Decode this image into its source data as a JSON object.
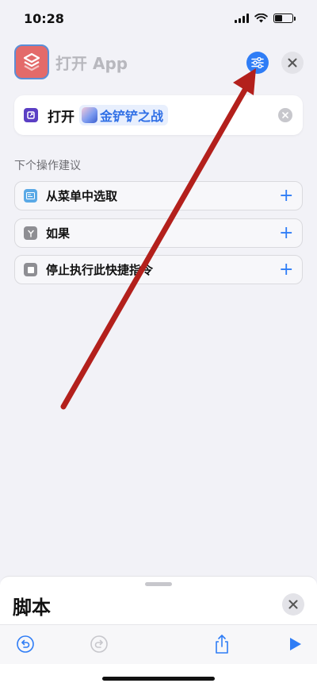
{
  "status_bar": {
    "time": "10:28",
    "battery_level": 0.45
  },
  "header": {
    "title": "打开 App",
    "app_icon": "shortcuts-icon",
    "settings_icon": "sliders-icon",
    "close_icon": "close-icon"
  },
  "action": {
    "verb": "打开",
    "app_name": "金铲铲之战",
    "icon": "open-app-icon",
    "clear_icon": "clear-icon"
  },
  "suggestions": {
    "title": "下个操作建议",
    "items": [
      {
        "label": "从菜单中选取",
        "icon": "menu-icon",
        "color": "#5aa9e6"
      },
      {
        "label": "如果",
        "icon": "branch-icon",
        "color": "#8e8e93"
      },
      {
        "label": "停止执行此快捷指令",
        "icon": "stop-icon",
        "color": "#8e8e93"
      }
    ]
  },
  "bottom_panel": {
    "title": "脚本",
    "toolbar": [
      "undo-icon",
      "redo-icon",
      "share-icon",
      "play-icon"
    ]
  },
  "colors": {
    "accent": "#2f7df6",
    "annotation": "#b3201c",
    "app_icon": "#e36a6a"
  }
}
